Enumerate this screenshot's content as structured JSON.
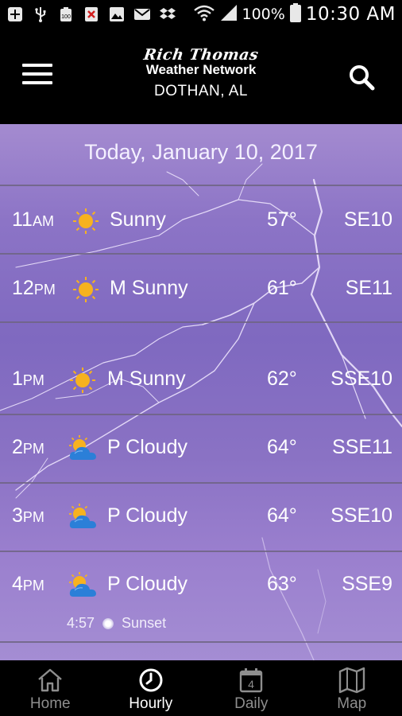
{
  "status_bar": {
    "battery": "100%",
    "time": "10:30 AM",
    "icons": [
      "add-icon",
      "usb-icon",
      "battery-saver-icon",
      "blocked-file-icon",
      "image-icon",
      "mail-icon",
      "dropbox-icon",
      "wifi-icon",
      "signal-icon",
      "battery-icon"
    ]
  },
  "header": {
    "brand_script": "Rich Thomas",
    "brand_name": "Weather Network",
    "location": "DOTHAN, AL"
  },
  "date": "Today, January 10, 2017",
  "hours": [
    {
      "hour": "11",
      "ampm": "AM",
      "icon": "sunny-icon",
      "condition": "Sunny",
      "temp": "57°",
      "wind": "SE10"
    },
    {
      "hour": "12",
      "ampm": "PM",
      "icon": "sunny-icon",
      "condition": "M Sunny",
      "temp": "61°",
      "wind": "SE11"
    },
    {
      "hour": "1",
      "ampm": "PM",
      "icon": "sunny-icon",
      "condition": "M Sunny",
      "temp": "62°",
      "wind": "SSE10"
    },
    {
      "hour": "2",
      "ampm": "PM",
      "icon": "partly-cloudy-icon",
      "condition": "P Cloudy",
      "temp": "64°",
      "wind": "SSE11"
    },
    {
      "hour": "3",
      "ampm": "PM",
      "icon": "partly-cloudy-icon",
      "condition": "P Cloudy",
      "temp": "64°",
      "wind": "SSE10"
    },
    {
      "hour": "4",
      "ampm": "PM",
      "icon": "partly-cloudy-icon",
      "condition": "P Cloudy",
      "temp": "63°",
      "wind": "SSE9"
    }
  ],
  "sunset": {
    "time": "4:57",
    "label": "Sunset"
  },
  "nav": [
    {
      "label": "Home",
      "icon": "home-icon",
      "active": false
    },
    {
      "label": "Hourly",
      "icon": "clock-icon",
      "active": true
    },
    {
      "label": "Daily",
      "icon": "calendar-icon",
      "badge": "4",
      "active": false
    },
    {
      "label": "Map",
      "icon": "map-icon",
      "active": false
    }
  ]
}
